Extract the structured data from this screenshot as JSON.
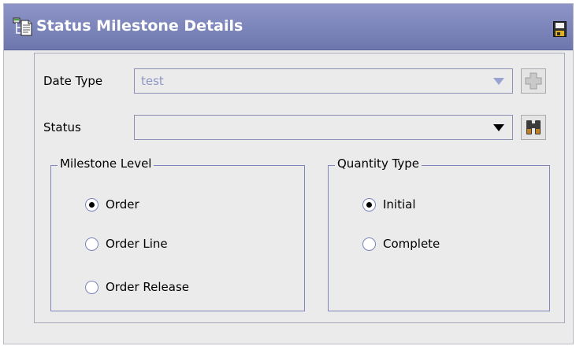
{
  "header": {
    "title": "Status Milestone Details"
  },
  "form": {
    "date_type": {
      "label": "Date Type",
      "value": "test",
      "disabled": true
    },
    "status": {
      "label": "Status",
      "value": ""
    },
    "milestone_level": {
      "legend": "Milestone Level",
      "options": [
        {
          "label": "Order",
          "checked": true
        },
        {
          "label": "Order Line",
          "checked": false
        },
        {
          "label": "Order Release",
          "checked": false
        }
      ]
    },
    "quantity_type": {
      "legend": "Quantity Type",
      "options": [
        {
          "label": "Initial",
          "checked": true
        },
        {
          "label": "Complete",
          "checked": false
        }
      ]
    }
  },
  "icons": {
    "title": "document-tree-icon",
    "save": "save-icon",
    "add": "add-icon",
    "lookup": "binoculars-icon",
    "dropdown": "chevron-down-icon"
  },
  "colors": {
    "titlebar": "#7780b8",
    "panel_background": "#ebebeb",
    "border": "#7e86bc",
    "disabled_text": "#8e97c6"
  }
}
